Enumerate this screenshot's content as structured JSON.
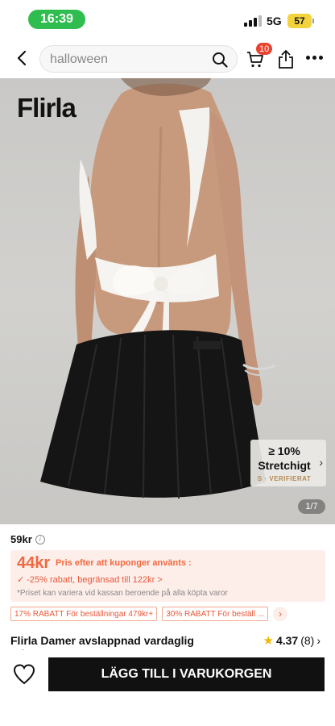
{
  "status_bar": {
    "time": "16:39",
    "network": "5G",
    "battery": "57"
  },
  "header": {
    "search_value": "halloween",
    "cart_count": "10",
    "icons": [
      "back-icon",
      "search-icon",
      "cart-icon",
      "share-icon",
      "more-icon"
    ]
  },
  "hero": {
    "brand": "Flirla",
    "stretch_value": "≥ 10%",
    "stretch_label": "Stretchigt",
    "stretch_verified": "VERIFIERAT",
    "page_indicator": "1/7"
  },
  "price": {
    "current": "59kr",
    "coupon_price": "44kr",
    "coupon_note": "Pris efter att kuponger använts :",
    "discount_text": "✓ -25% rabatt, begränsad till 122kr >",
    "disclaimer": "*Priset kan variera vid kassan beroende på alla köpta varor"
  },
  "tags": [
    {
      "label": "17% RABATT För beställningar 479kr+"
    },
    {
      "label": "30% RABATT För beställ ..."
    }
  ],
  "product": {
    "title": "Flirla Damer avslappnad vardaglig Mångsidig Slim Fit Rygglös Crop...",
    "rating": "4.37",
    "review_count": "(8)"
  },
  "bottom": {
    "add_to_cart": "LÄGG TILL I VARUKORGEN"
  },
  "colors": {
    "accent": "#f2693f",
    "status_green": "#2fbd4f",
    "badge_red": "#e8432e",
    "battery_yellow": "#f2d33c"
  }
}
